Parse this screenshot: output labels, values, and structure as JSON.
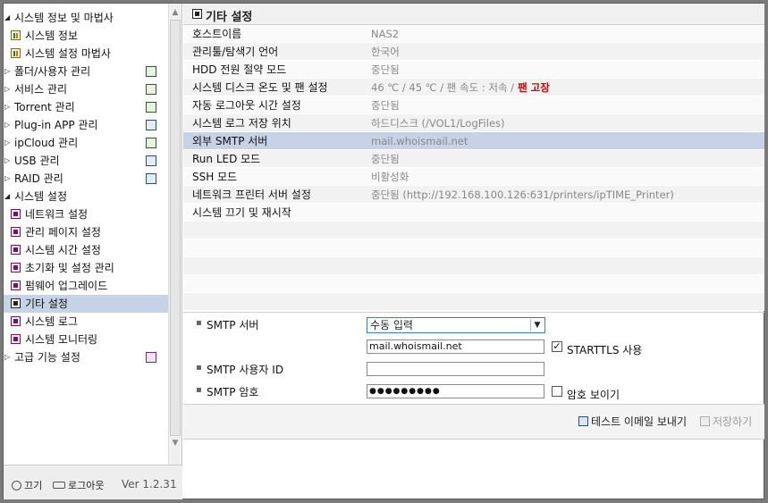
{
  "sidebar": {
    "items": [
      {
        "type": "parent",
        "label": "시스템 정보 및 마법사"
      },
      {
        "type": "child",
        "icon": "chart",
        "label": "시스템 정보"
      },
      {
        "type": "child",
        "icon": "chart",
        "label": "시스템 설정 마법사"
      },
      {
        "type": "parent",
        "label": "폴더/사용자 관리"
      },
      {
        "type": "parent",
        "label": "서비스 관리"
      },
      {
        "type": "parent",
        "label": "Torrent 관리"
      },
      {
        "type": "parent",
        "label": "Plug-in APP 관리"
      },
      {
        "type": "parent",
        "label": "ipCloud 관리"
      },
      {
        "type": "parent",
        "label": "USB 관리"
      },
      {
        "type": "parent",
        "label": "RAID 관리"
      },
      {
        "type": "parent",
        "label": "시스템 설정"
      },
      {
        "type": "child",
        "icon": "sys",
        "label": "네트워크 설정"
      },
      {
        "type": "child",
        "icon": "sys",
        "label": "관리 페이지 설정"
      },
      {
        "type": "child",
        "icon": "sys",
        "label": "시스템 시간 설정"
      },
      {
        "type": "child",
        "icon": "sys",
        "label": "초기화 및 설정 관리"
      },
      {
        "type": "child",
        "icon": "sys",
        "label": "펌웨어 업그레이드"
      },
      {
        "type": "child",
        "icon": "sys",
        "label": "기타 설정",
        "selected": true
      },
      {
        "type": "child",
        "icon": "sys",
        "label": "시스템 로그"
      },
      {
        "type": "child",
        "icon": "sys",
        "label": "시스템 모니터링"
      },
      {
        "type": "parent",
        "label": "고급 기능 설정"
      }
    ],
    "footer": {
      "power": "끄기",
      "logout": "로그아웃",
      "version": "Ver 1.2.31"
    }
  },
  "main": {
    "title": "기타 설정",
    "rows": [
      {
        "key": "호스트이름",
        "value": "NAS2"
      },
      {
        "key": "관리툴/탐색기 언어",
        "value": "한국어"
      },
      {
        "key": "HDD 전원 절약 모드",
        "value": "중단됨"
      },
      {
        "key": "시스템 디스크 온도 및 팬 설정",
        "value": "46 ℃ / 45 ℃ / 팬 속도 : 저속 /",
        "alert": "팬 고장"
      },
      {
        "key": "자동 로그아웃 시간 설정",
        "value": "중단됨"
      },
      {
        "key": "시스템 로그 저장 위치",
        "value": "하드디스크 (/VOL1/LogFiles)"
      },
      {
        "key": "외부 SMTP 서버",
        "value": "mail.whoismail.net",
        "selected": true
      },
      {
        "key": "Run LED 모드",
        "value": "중단됨"
      },
      {
        "key": "SSH 모드",
        "value": "비활성화"
      },
      {
        "key": "네트워크 프린터 서버 설정",
        "value": "중단됨 (http://192.168.100.126:631/printers/ipTIME_Printer)"
      },
      {
        "key": "시스템 끄기 및 재시작",
        "value": ""
      }
    ],
    "form": {
      "smtp_server_label": "SMTP 서버",
      "smtp_mode": "수동 입력",
      "smtp_host": "mail.whoismail.net",
      "starttls_label": "STARTTLS 사용",
      "starttls_checked": "✓",
      "user_label": "SMTP 사용자 ID",
      "user_value": "",
      "pass_label": "SMTP 암호",
      "pass_value": "●●●●●●●●●",
      "show_pass_label": "암호 보이기"
    },
    "actions": {
      "test_email": "테스트 이메일 보내기",
      "save": "저장하기"
    }
  }
}
